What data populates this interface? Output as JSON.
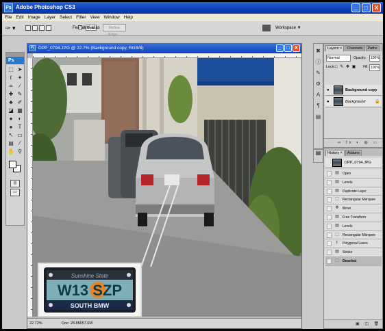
{
  "app": {
    "title": "Adobe Photoshop CS3",
    "logo": "Ps"
  },
  "window_buttons": {
    "minimize": "_",
    "maximize": "□",
    "close": "X"
  },
  "menu": [
    "File",
    "Edit",
    "Image",
    "Layer",
    "Select",
    "Filter",
    "View",
    "Window",
    "Help"
  ],
  "options_bar": {
    "feather_label": "Feather:",
    "feather_value": "0 px",
    "antialias_label": "Anti-alias",
    "antialias_checked": true,
    "refine_edge": "Refine Edge...",
    "workspace": "Workspace ▼"
  },
  "toolbox": {
    "badge": "Ps",
    "icons": [
      "marquee-icon",
      "move-icon",
      "lasso-icon",
      "magic-wand-icon",
      "crop-icon",
      "slice-icon",
      "healing-brush-icon",
      "brush-icon",
      "clone-stamp-icon",
      "history-brush-icon",
      "eraser-icon",
      "gradient-icon",
      "blur-icon",
      "dodge-icon",
      "pen-icon",
      "type-icon",
      "path-select-icon",
      "shape-icon",
      "notes-icon",
      "eyedropper-icon",
      "hand-icon",
      "zoom-icon"
    ]
  },
  "document": {
    "title": "DPP_0794.JPG @ 22.7% (Background copy, RGB/8)",
    "zoom": "22.72%",
    "doc_size": "Doc: 28.8M/57.6M",
    "plate": {
      "top_text": "Sunshine State",
      "number": "W13 SZP",
      "bottom_text": "SOUTH BMW"
    }
  },
  "layers_panel": {
    "tabs": [
      "Layers ×",
      "Channels",
      "Paths"
    ],
    "blend_mode": "Normal",
    "opacity_label": "Opacity:",
    "opacity_value": "100%",
    "lock_label": "Lock:",
    "lock_icons": "□ ✎ ✥ ▣",
    "fill_label": "Fill:",
    "fill_value": "100%",
    "layers": [
      {
        "name": "Background copy",
        "active": true
      },
      {
        "name": "Background",
        "active": false
      }
    ]
  },
  "history_panel": {
    "tabs": [
      "History ×",
      "Actions"
    ],
    "snapshot": "DPP_0794.JPG",
    "items": [
      {
        "label": "Open",
        "icon": "▤"
      },
      {
        "label": "Levels",
        "icon": "▤"
      },
      {
        "label": "Duplicate Layer",
        "icon": "▤"
      },
      {
        "label": "Rectangular Marquee",
        "icon": "⬚"
      },
      {
        "label": "Move",
        "icon": "✥"
      },
      {
        "label": "Free Transform",
        "icon": "▤"
      },
      {
        "label": "Levels",
        "icon": "▤"
      },
      {
        "label": "Rectangular Marquee",
        "icon": "⬚"
      },
      {
        "label": "Polygonal Lasso",
        "icon": "ℓ"
      },
      {
        "label": "Stroke",
        "icon": "▤"
      },
      {
        "label": "Deselect",
        "icon": "⬚"
      }
    ],
    "selected_index": 10
  }
}
